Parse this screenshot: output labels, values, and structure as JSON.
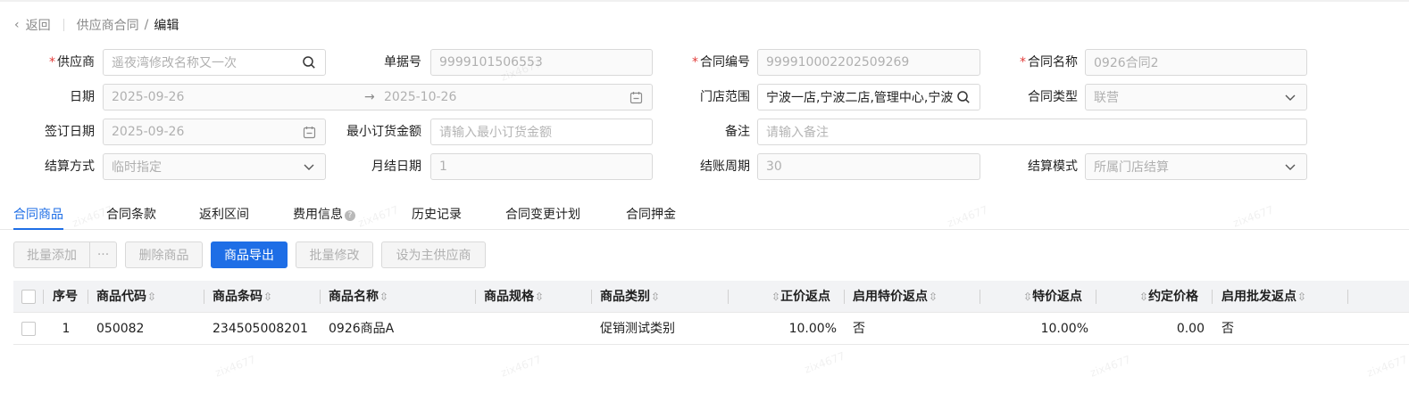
{
  "breadcrumb": {
    "back": "返回",
    "parent": "供应商合同",
    "separator": "/",
    "current": "编辑"
  },
  "form": {
    "supplier": {
      "label": "供应商",
      "required": true,
      "value": "遥夜湾修改名称又一次",
      "icon": "search-icon"
    },
    "doc_no": {
      "label": "单据号",
      "value": "9999101506553"
    },
    "contract_no": {
      "label": "合同编号",
      "required": true,
      "value": "999910002202509269"
    },
    "contract_name": {
      "label": "合同名称",
      "required": true,
      "value": "0926合同2"
    },
    "date": {
      "label": "日期",
      "start": "2025-09-26",
      "arrow": "→",
      "end": "2025-10-26",
      "icon": "calendar-icon"
    },
    "store_scope": {
      "label": "门店范围",
      "value": "宁波一店,宁波二店,管理中心,宁波",
      "icon": "search-icon"
    },
    "contract_type": {
      "label": "合同类型",
      "value": "联营",
      "icon": "chevron-down-icon"
    },
    "sign_date": {
      "label": "签订日期",
      "value": "2025-09-26",
      "icon": "calendar-icon"
    },
    "min_order": {
      "label": "最小订货金额",
      "placeholder": "请输入最小订货金额"
    },
    "remark": {
      "label": "备注",
      "placeholder": "请输入备注"
    },
    "settle_method": {
      "label": "结算方式",
      "value": "临时指定",
      "icon": "chevron-down-icon"
    },
    "monthly_day": {
      "label": "月结日期",
      "value": "1"
    },
    "billing_cycle": {
      "label": "结账周期",
      "value": "30"
    },
    "settle_mode": {
      "label": "结算模式",
      "value": "所属门店结算",
      "icon": "chevron-down-icon"
    }
  },
  "tabs": [
    {
      "label": "合同商品",
      "active": true
    },
    {
      "label": "合同条款"
    },
    {
      "label": "返利区间"
    },
    {
      "label": "费用信息",
      "info_icon": "question-icon"
    },
    {
      "label": "历史记录"
    },
    {
      "label": "合同变更计划"
    },
    {
      "label": "合同押金"
    }
  ],
  "toolbar": {
    "batch_add": "批量添加",
    "more": "···",
    "delete": "删除商品",
    "export": "商品导出",
    "batch_edit": "批量修改",
    "set_main": "设为主供应商"
  },
  "table": {
    "columns": [
      "序号",
      "商品代码",
      "商品条码",
      "商品名称",
      "商品规格",
      "商品类别",
      "正价返点",
      "启用特价返点",
      "特价返点",
      "约定价格",
      "启用批发返点"
    ],
    "sort_icon": "sort-icon",
    "rows": [
      {
        "index": "1",
        "code": "050082",
        "barcode": "234505008201",
        "name": "0926商品A",
        "spec": "",
        "category": "促销测试类别",
        "price_rebate": "10.00%",
        "special_enabled": "否",
        "special_rebate": "10.00%",
        "agreed_price": "0.00",
        "wholesale_enabled": "否"
      }
    ]
  },
  "watermark": "zix4677",
  "colors": {
    "primary": "#1e6ee6",
    "required": "#e23c39",
    "header_bg": "#f2f3f5"
  }
}
